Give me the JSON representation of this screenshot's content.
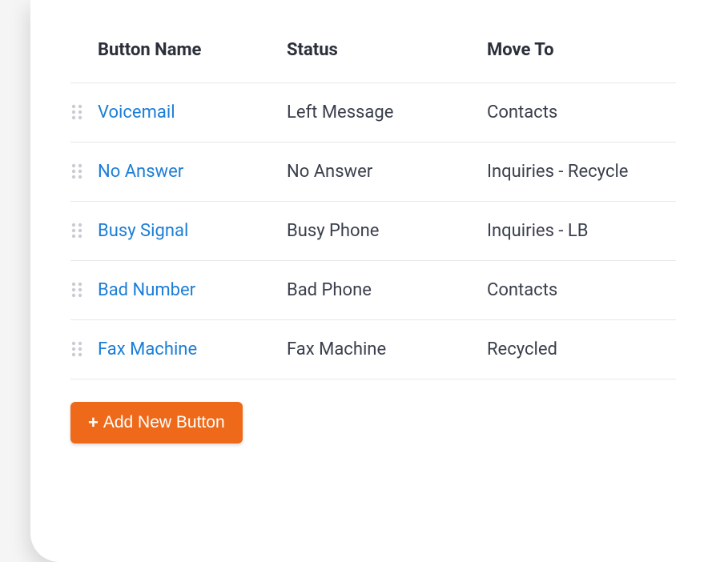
{
  "table": {
    "headers": {
      "button_name": "Button Name",
      "status": "Status",
      "move_to": "Move To"
    },
    "rows": [
      {
        "name": "Voicemail",
        "status": "Left Message",
        "move_to": "Contacts"
      },
      {
        "name": "No Answer",
        "status": "No Answer",
        "move_to": "Inquiries - Recycle"
      },
      {
        "name": "Busy Signal",
        "status": "Busy Phone",
        "move_to": "Inquiries - LB"
      },
      {
        "name": "Bad Number",
        "status": "Bad Phone",
        "move_to": "Contacts"
      },
      {
        "name": "Fax Machine",
        "status": "Fax Machine",
        "move_to": "Recycled"
      }
    ]
  },
  "actions": {
    "add_new_button_label": "Add New Button"
  },
  "colors": {
    "link": "#1c7ed6",
    "primary": "#ee6a1a",
    "text": "#3a3f4c",
    "header_text": "#2b2f3a",
    "border": "#e8e8e8"
  }
}
